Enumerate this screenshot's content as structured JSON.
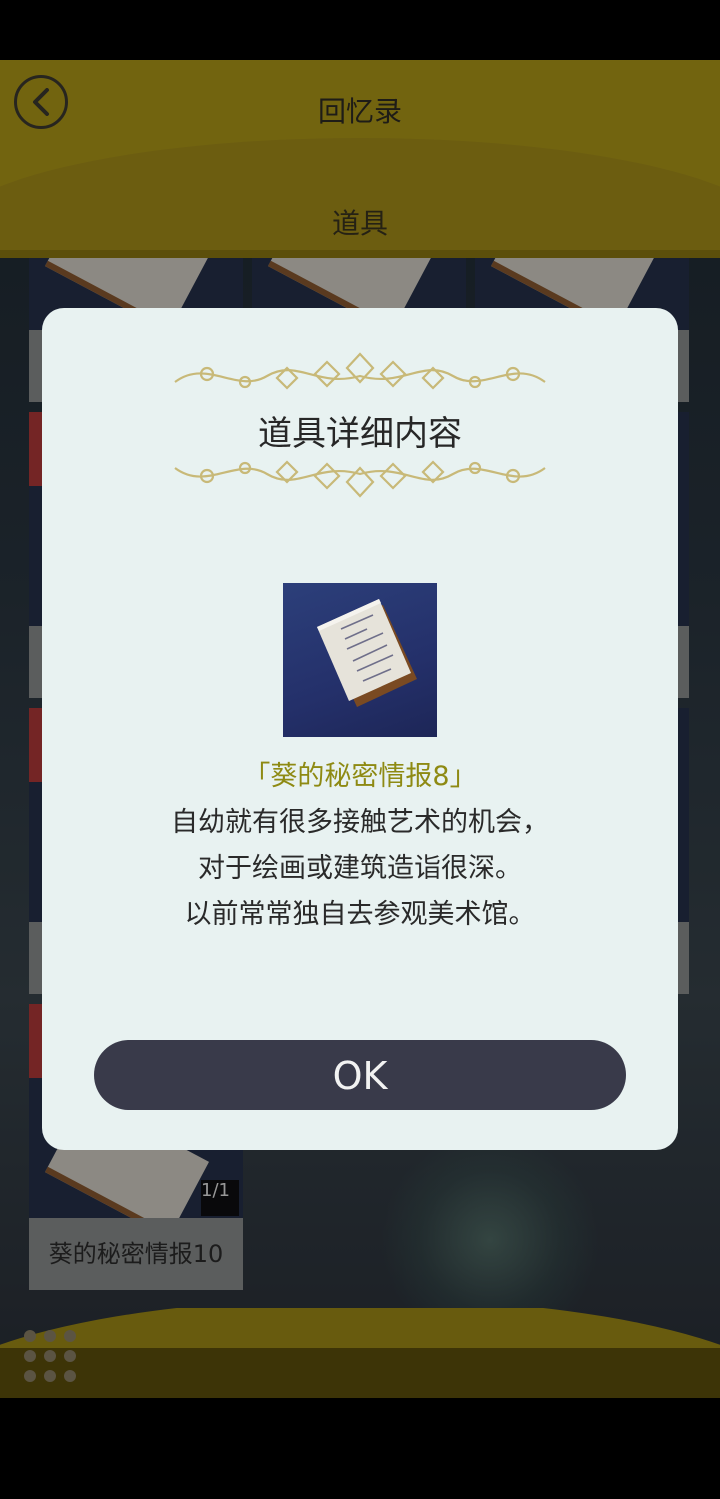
{
  "header": {
    "title": "回忆录",
    "subtitle": "道具",
    "back_icon": "chevron-left-icon"
  },
  "grid": {
    "count": "1/1",
    "last_item_label": "葵的秘密情报10"
  },
  "modal": {
    "title": "道具详细内容",
    "item_name": "「葵的秘密情报8」",
    "description": [
      "自幼就有很多接触艺术的机会，",
      "对于绘画或建筑造诣很深。",
      "以前常常独自去参观美术馆。"
    ],
    "ok_label": "OK",
    "item_icon": "notebook-icon",
    "ornament": "vine-ornament-icon"
  },
  "footer": {
    "menu_icon": "grid-menu-icon"
  },
  "colors": {
    "header": "#b09a18",
    "modal_bg": "#e8f2f1",
    "item_name": "#8e8a13",
    "button": "#393a4a"
  }
}
